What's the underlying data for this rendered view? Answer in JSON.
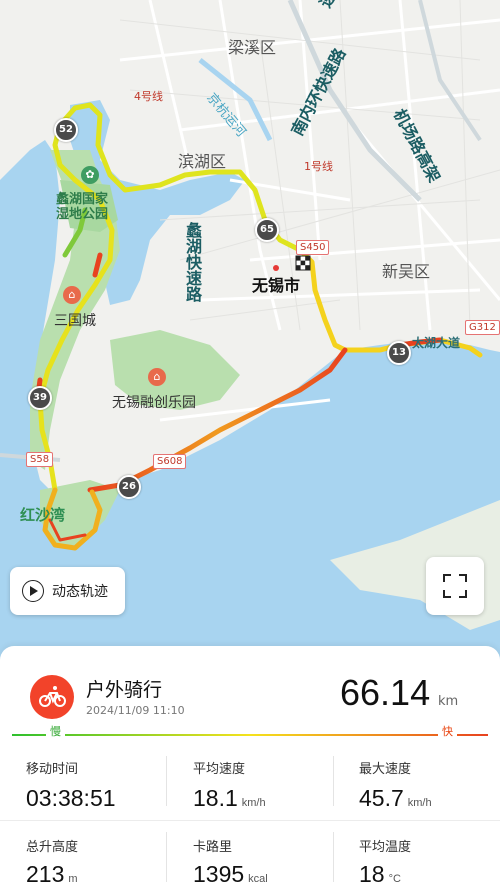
{
  "map": {
    "districts": [
      "梁溪区",
      "滨湖区",
      "新吴区"
    ],
    "roads": {
      "beijing_hangzhou_canal": "京杭运河",
      "south_inner_ring": "南内环快速路",
      "airport_highway": "机场路高架",
      "lihu_expressway": "蠡湖快速路",
      "top_road_fragment": "速路",
      "line4": "4号线",
      "line1": "1号线",
      "s450": "S450",
      "s608": "S608",
      "s58": "S58",
      "g312": "G312",
      "taihu_road_fragment": "太湖大道"
    },
    "places": {
      "city": "无锡市",
      "wetland_park": "蠡湖国家湿地公园",
      "wetland_line1": "蠡湖国家",
      "wetland_line2": "湿地公园",
      "three_kingdoms": "三国城",
      "sunac": "无锡融创乐园",
      "bay": "红沙湾"
    },
    "km_markers": [
      "52",
      "65",
      "13",
      "39",
      "26"
    ],
    "colors": {
      "water": "#a8d4f0",
      "land": "#f1f1ee",
      "park": "#b9dfae",
      "route_slow": "#2ec02e",
      "route_mid": "#f5e21d",
      "route_fast": "#e8421f"
    }
  },
  "controls": {
    "replay_label": "动态轨迹",
    "replay_icon": "play-circle-icon",
    "fullscreen_icon": "fullscreen-icon"
  },
  "summary": {
    "activity_type": "户外骑行",
    "datetime": "2024/11/09 11:10",
    "distance": "66.14",
    "distance_unit": "km",
    "speed_legend": {
      "slow": "慢",
      "fast": "快"
    }
  },
  "stats": [
    {
      "label": "移动时间",
      "value": "03:38:51",
      "unit": ""
    },
    {
      "label": "平均速度",
      "value": "18.1",
      "unit": "km/h"
    },
    {
      "label": "最大速度",
      "value": "45.7",
      "unit": "km/h"
    },
    {
      "label": "总升高度",
      "value": "213",
      "unit": "m"
    },
    {
      "label": "卡路里",
      "value": "1395",
      "unit": "kcal"
    },
    {
      "label": "平均温度",
      "value": "18",
      "unit": "°C"
    }
  ]
}
